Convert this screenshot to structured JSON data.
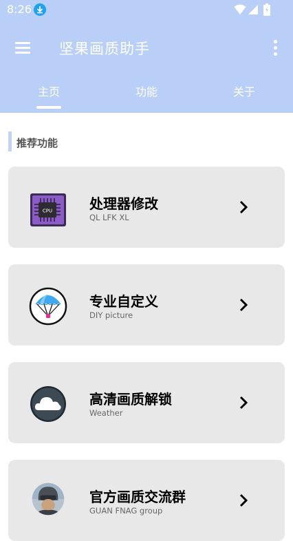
{
  "status_bar": {
    "time": "8:26"
  },
  "toolbar": {
    "title": "坚果画质助手"
  },
  "tabs": [
    {
      "label": "主页",
      "active": true
    },
    {
      "label": "功能",
      "active": false
    },
    {
      "label": "关于",
      "active": false
    }
  ],
  "section": {
    "title": "推荐功能"
  },
  "cards": [
    {
      "title": "处理器修改",
      "subtitle": "QL LFK XL",
      "icon": "cpu-icon"
    },
    {
      "title": "专业自定义",
      "subtitle": "DIY picture",
      "icon": "parachute-icon"
    },
    {
      "title": "高清画质解锁",
      "subtitle": "Weather",
      "icon": "cloud-icon"
    },
    {
      "title": "官方画质交流群",
      "subtitle": "GUAN FNAG group",
      "icon": "avatar-icon"
    }
  ],
  "colors": {
    "header": "#b9cff7",
    "card": "#e8e8e8",
    "accent_bar": "#c3d2f6"
  }
}
